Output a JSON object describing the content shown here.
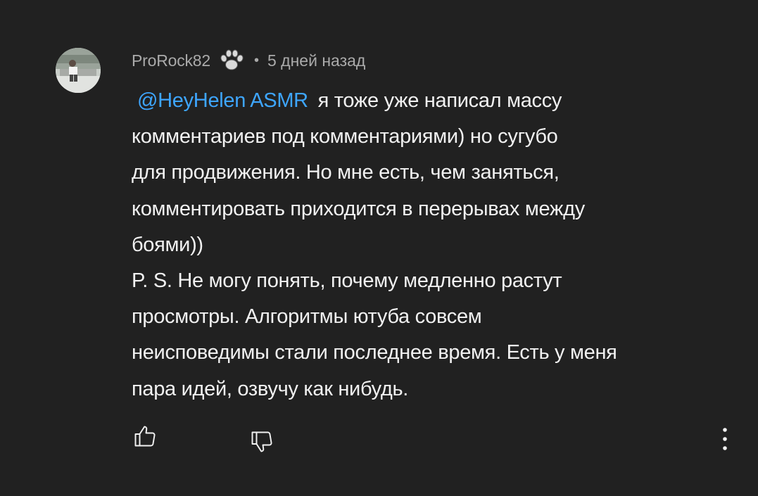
{
  "comment": {
    "author": "ProRock82",
    "badge_icon": "paw-print-icon",
    "separator": "•",
    "time_ago": "5 дней назад",
    "mention": "@HeyHelen ASMR",
    "lines": [
      "я тоже уже написал массу",
      "комментариев под комментариями) но сугубо",
      "для продвижения. Но мне есть, чем заняться,",
      "комментировать приходится в перерывах между",
      "боями))",
      "P. S. Не могу понять, почему медленно растут",
      "просмотры. Алгоритмы ютуба совсем",
      "неисповедимы стали последнее время. Есть у меня",
      "пара идей, озвучу как нибудь."
    ]
  },
  "actions": {
    "like_icon": "thumbs-up-icon",
    "dislike_icon": "thumbs-down-icon",
    "more_icon": "more-vertical-icon"
  },
  "colors": {
    "background": "#212121",
    "text": "#f1f1f1",
    "secondary_text": "#aaaaaa",
    "mention": "#3ea6ff"
  }
}
